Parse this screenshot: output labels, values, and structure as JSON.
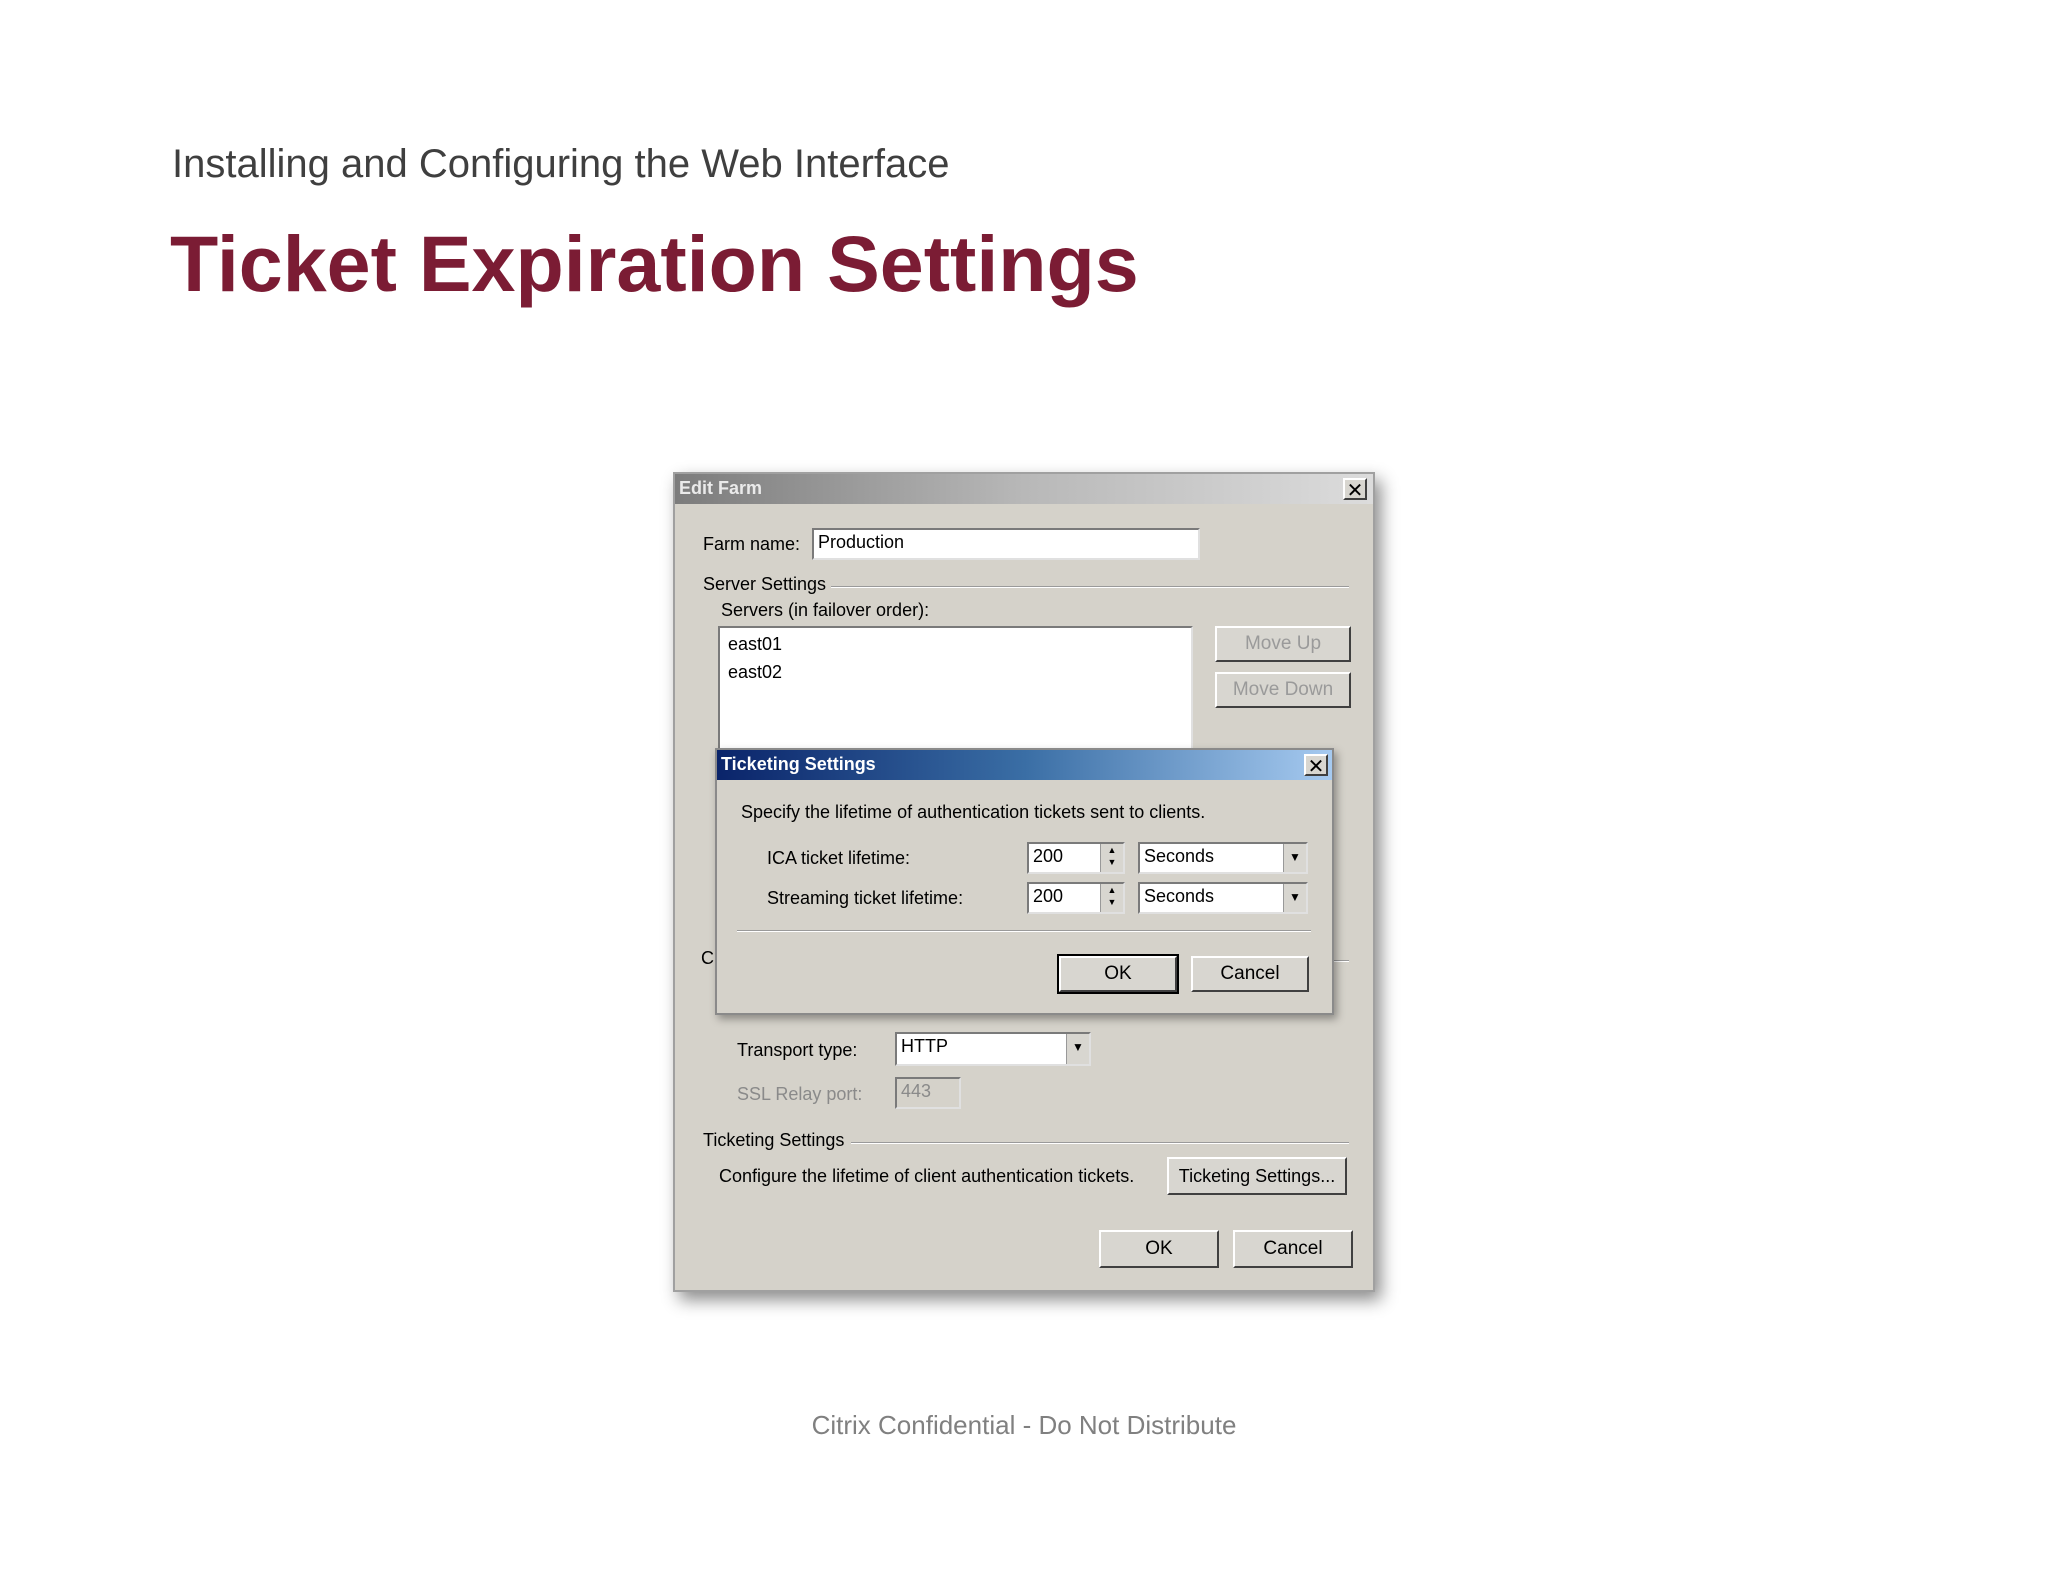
{
  "slide": {
    "subtitle": "Installing and Configuring the Web Interface",
    "title": "Ticket Expiration Settings",
    "footer": "Citrix Confidential - Do Not Distribute"
  },
  "edit_farm": {
    "title": "Edit Farm",
    "close_symbol": "✕",
    "farm_name_label": "Farm name:",
    "farm_name_value": "Production",
    "server_settings_label": "Server Settings",
    "servers_label": "Servers (in failover order):",
    "servers": [
      "east01",
      "east02"
    ],
    "move_up_label": "Move Up",
    "move_down_label": "Move Down",
    "hidden_label_fragment": "C",
    "transport_type_label": "Transport type:",
    "transport_type_value": "HTTP",
    "ssl_relay_port_label": "SSL Relay port:",
    "ssl_relay_port_value": "443",
    "ticketing_settings_label": "Ticketing Settings",
    "ticketing_description": "Configure the lifetime of client authentication tickets.",
    "ticketing_settings_button": "Ticketing Settings...",
    "ok_label": "OK",
    "cancel_label": "Cancel"
  },
  "ticketing_dialog": {
    "title": "Ticketing Settings",
    "close_symbol": "✕",
    "description": "Specify the lifetime of authentication tickets sent to clients.",
    "ica_label": "ICA ticket lifetime:",
    "ica_value": "200",
    "ica_unit": "Seconds",
    "streaming_label": "Streaming ticket lifetime:",
    "streaming_value": "200",
    "streaming_unit": "Seconds",
    "ok_label": "OK",
    "cancel_label": "Cancel"
  },
  "icons": {
    "dropdown": "▼",
    "spin_up": "▲",
    "spin_down": "▼"
  }
}
